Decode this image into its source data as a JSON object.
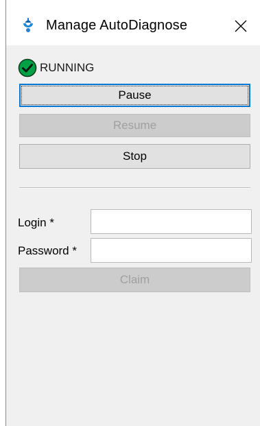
{
  "window": {
    "title": "Manage AutoDiagnose",
    "icon": "app-icon",
    "close_icon": "close-icon"
  },
  "status": {
    "icon": "check-circle-icon",
    "icon_color": "#00a046",
    "text": "RUNNING"
  },
  "controls": {
    "pause_label": "Pause",
    "resume_label": "Resume",
    "stop_label": "Stop"
  },
  "login": {
    "login_label": "Login *",
    "login_value": "",
    "password_label": "Password *",
    "password_value": "",
    "claim_label": "Claim"
  },
  "colors": {
    "accent": "#0078d7",
    "button_face": "#e1e1e1",
    "disabled_text": "#a0a0a0"
  }
}
